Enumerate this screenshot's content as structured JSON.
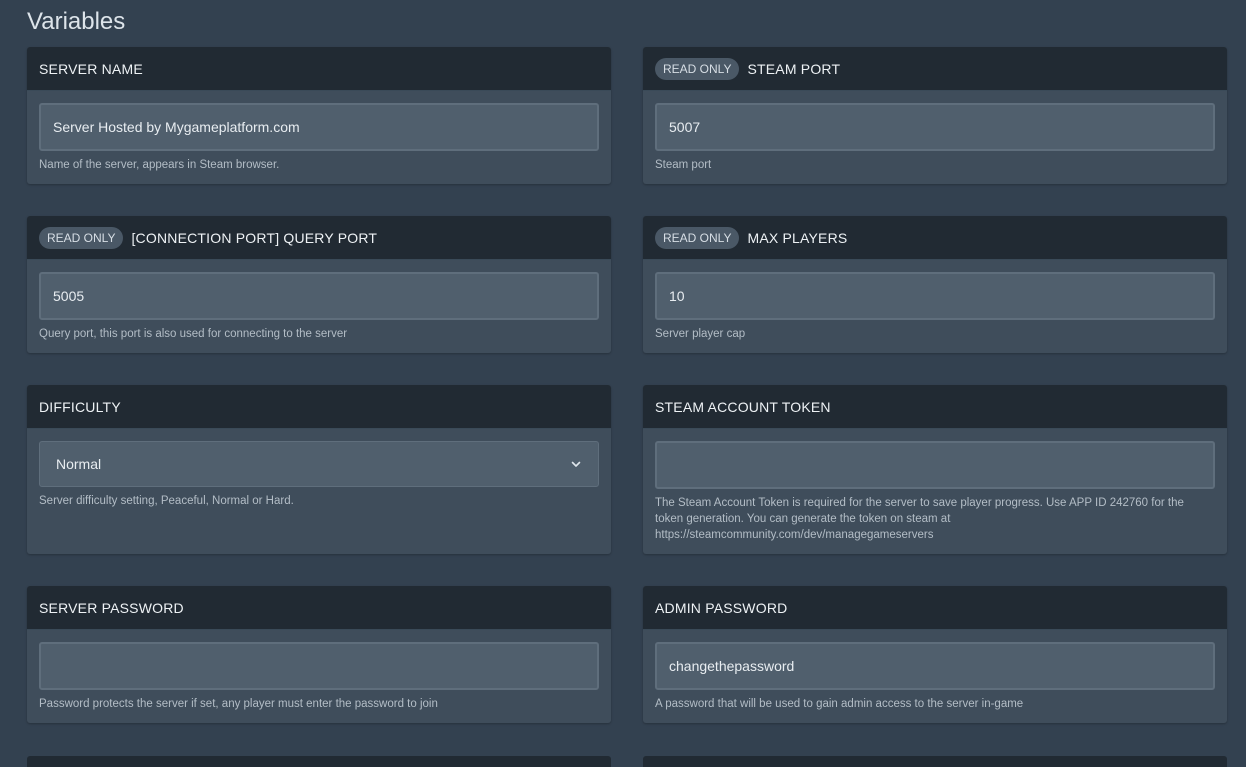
{
  "page": {
    "title": "Variables"
  },
  "cards": {
    "server_name": {
      "title": "SERVER NAME",
      "value": "Server Hosted by Mygameplatform.com",
      "help": "Name of the server, appears in Steam browser."
    },
    "steam_port": {
      "badge": "READ ONLY",
      "title": "STEAM PORT",
      "value": "5007",
      "help": "Steam port"
    },
    "query_port": {
      "badge": "READ ONLY",
      "title": "[CONNECTION PORT] QUERY PORT",
      "value": "5005",
      "help": "Query port, this port is also used for connecting to the server"
    },
    "max_players": {
      "badge": "READ ONLY",
      "title": "MAX PLAYERS",
      "value": "10",
      "help": "Server player cap"
    },
    "difficulty": {
      "title": "DIFFICULTY",
      "selected": "Normal",
      "help": "Server difficulty setting, Peaceful, Normal or Hard."
    },
    "steam_token": {
      "title": "STEAM ACCOUNT TOKEN",
      "value": "",
      "help": "The Steam Account Token is required for the server to save player progress. Use APP ID 242760 for the token generation.   You can generate the token on steam at https://steamcommunity.com/dev/managegameservers"
    },
    "server_password": {
      "title": "SERVER PASSWORD",
      "value": "",
      "help": "Password protects the server if set, any player must enter the password to join"
    },
    "admin_password": {
      "title": "ADMIN PASSWORD",
      "value": "changethepassword",
      "help": "A password that will be used to gain admin access to the server in-game"
    }
  },
  "icons": {
    "dropdown": "chevron-down-icon"
  },
  "colors": {
    "background": "#334150",
    "card": "#3f4d5b",
    "header": "#212a33",
    "input": "#505f6d"
  }
}
